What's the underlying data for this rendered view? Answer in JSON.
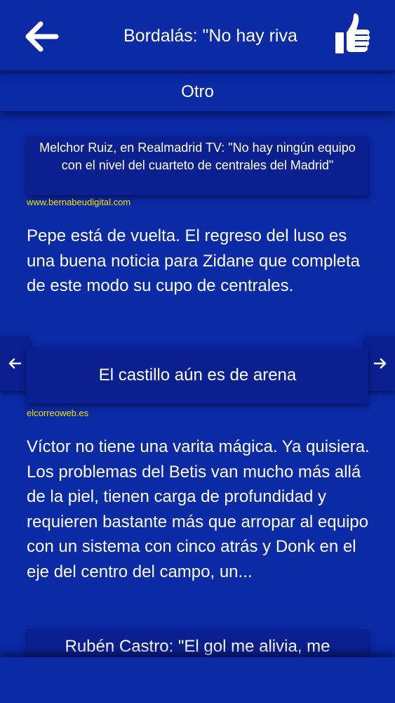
{
  "header": {
    "title": "Bordalás: \"No hay riva",
    "back_icon": "arrow-left-icon",
    "like_icon": "thumbs-up-icon"
  },
  "category": {
    "label": "Otro"
  },
  "news": [
    {
      "title": "Melchor Ruiz, en Realmadrid TV: \"No hay ningún equipo con el nivel del cuarteto de centrales del Madrid\"",
      "source": "www.bernabeudigital.com",
      "summary": "Pepe está de vuelta. El regreso del luso es una buena noticia para Zidane que completa de este modo su cupo de centrales."
    },
    {
      "title": "El castillo aún es de arena",
      "source": "elcorreoweb.es",
      "summary": "Víctor no tiene una varita mágica. Ya quisiera. Los problemas del Betis van mucho más allá de la piel, tienen carga de profundidad y requieren bastante más que arropar al equipo con un sistema con cinco atrás y Donk en el eje del centro del campo, un..."
    },
    {
      "title": "Rubén Castro: \"El gol me alivia, me"
    }
  ],
  "navigation": {
    "prev_icon": "arrow-left-icon",
    "next_icon": "arrow-right-icon"
  },
  "colors": {
    "background": "#0a2aa6",
    "title_box": "#0b2090",
    "source_link": "#f2e200",
    "text": "#ffffff"
  }
}
